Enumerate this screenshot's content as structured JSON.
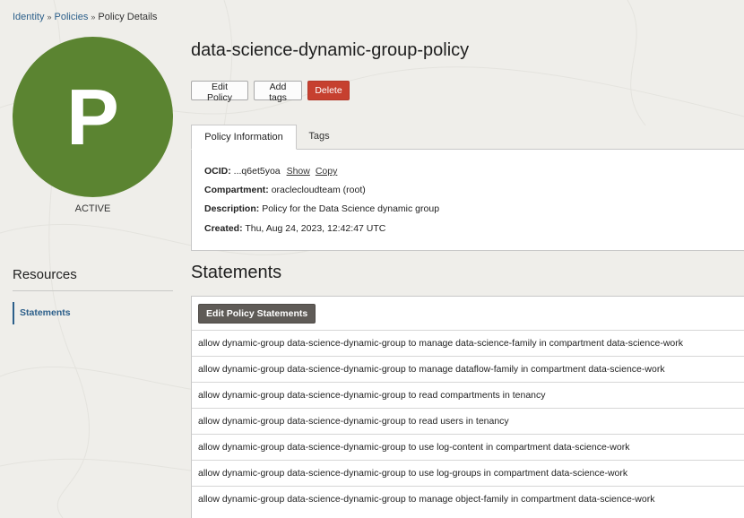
{
  "breadcrumb": {
    "items": [
      "Identity",
      "Policies",
      "Policy Details"
    ],
    "separator": "»"
  },
  "avatar": {
    "letter": "P",
    "color": "#5b8431"
  },
  "status": "ACTIVE",
  "resources": {
    "title": "Resources",
    "items": [
      {
        "label": "Statements"
      }
    ]
  },
  "policy": {
    "title": "data-science-dynamic-group-policy"
  },
  "actions": {
    "edit": "Edit Policy",
    "add_tags": "Add tags",
    "delete": "Delete"
  },
  "tabs": [
    {
      "label": "Policy Information"
    },
    {
      "label": "Tags"
    }
  ],
  "info": {
    "ocid_label": "OCID:",
    "ocid_value": "...q6et5yoa",
    "show": "Show",
    "copy": "Copy",
    "compartment_label": "Compartment:",
    "compartment_value": "oraclecloudteam (root)",
    "description_label": "Description:",
    "description_value": "Policy for the Data Science dynamic group",
    "created_label": "Created:",
    "created_value": "Thu, Aug 24, 2023, 12:42:47 UTC"
  },
  "statements": {
    "title": "Statements",
    "edit_button": "Edit Policy Statements",
    "items": [
      "allow dynamic-group data-science-dynamic-group to manage data-science-family in compartment data-science-work",
      "allow dynamic-group data-science-dynamic-group to manage dataflow-family in compartment data-science-work",
      "allow dynamic-group data-science-dynamic-group to read compartments in tenancy",
      "allow dynamic-group data-science-dynamic-group to read users in tenancy",
      "allow dynamic-group data-science-dynamic-group to use log-content in compartment data-science-work",
      "allow dynamic-group data-science-dynamic-group to use log-groups in compartment data-science-work",
      "allow dynamic-group data-science-dynamic-group to manage object-family in compartment data-science-work"
    ]
  },
  "colors": {
    "link": "#2c5f8a",
    "danger": "#c6402f",
    "dark_button": "#5f5b57",
    "background": "#efeeea"
  }
}
